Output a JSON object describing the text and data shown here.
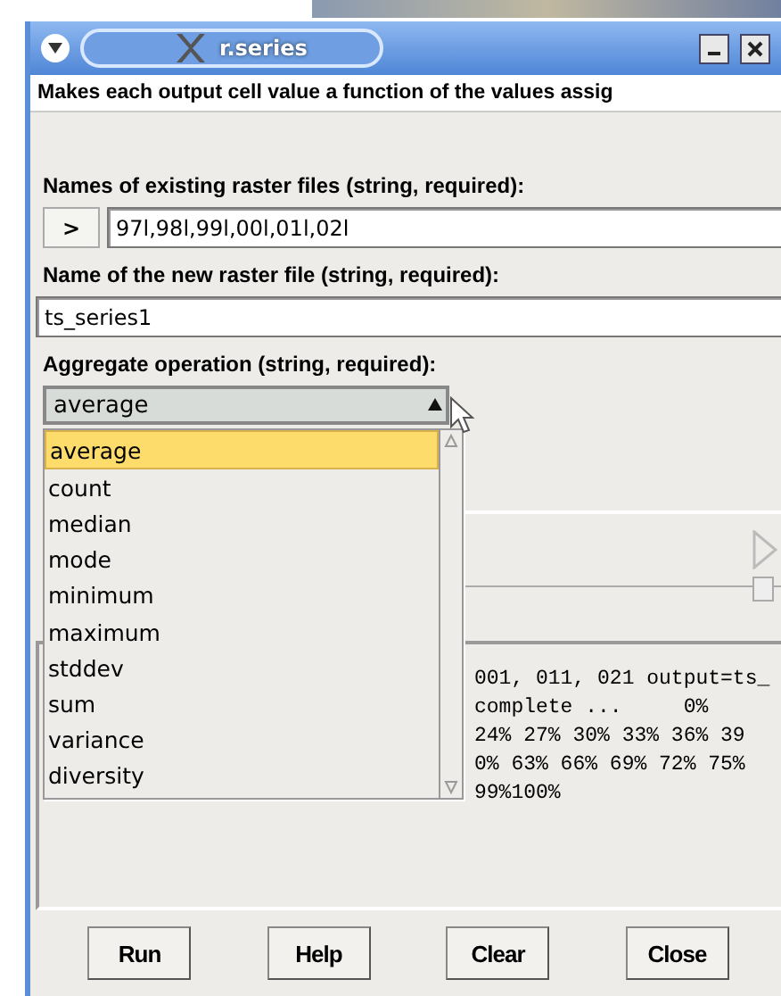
{
  "window": {
    "title": "r.series"
  },
  "description": "Makes each output cell value a function of the values assig",
  "inputs": [
    {
      "kind": "multi",
      "label": "Names of existing raster files (string, required):",
      "button": ">",
      "value": "97l,98l,99l,00l,01l,02l"
    },
    {
      "kind": "text",
      "label": "Name of the new raster file (string, required):",
      "value": "ts_series1"
    }
  ],
  "aggregate": {
    "label": "Aggregate operation (string, required):",
    "value": "average",
    "expanded": true,
    "options": [
      {
        "label": "average",
        "selected": true
      },
      {
        "label": "count",
        "selected": false
      },
      {
        "label": "median",
        "selected": false
      },
      {
        "label": "mode",
        "selected": false
      },
      {
        "label": "minimum",
        "selected": false
      },
      {
        "label": "maximum",
        "selected": false
      },
      {
        "label": "stddev",
        "selected": false
      },
      {
        "label": "sum",
        "selected": false
      },
      {
        "label": "variance",
        "selected": false
      },
      {
        "label": "diversity",
        "selected": false
      }
    ]
  },
  "output": [
    "001, 011, 021 output=ts_",
    "complete ...     0%",
    "24% 27% 30% 33% 36% 39",
    "0% 63% 66% 69% 72% 75%",
    "99%100%"
  ],
  "buttons": [
    "Run",
    "Help",
    "Clear",
    "Close"
  ]
}
